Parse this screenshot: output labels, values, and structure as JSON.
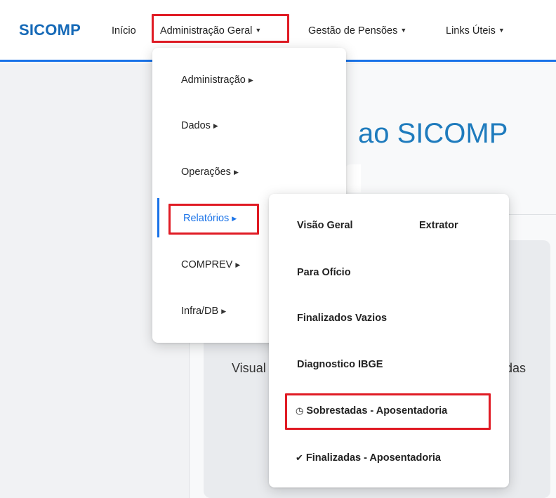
{
  "navbar": {
    "brand": "SICOMP",
    "links": [
      {
        "label": "Início"
      },
      {
        "label": "Administração Geral"
      },
      {
        "label": "Gestão de Pensões"
      },
      {
        "label": "Links Úteis"
      }
    ]
  },
  "page": {
    "welcome_heading": "ao SICOMP",
    "card_text_left": "Visual",
    "card_text_right": "das"
  },
  "admin_menu": {
    "items": [
      {
        "label": "Administração"
      },
      {
        "label": "Dados"
      },
      {
        "label": "Operações"
      },
      {
        "label": "Relatórios"
      },
      {
        "label": "COMPREV"
      },
      {
        "label": "Infra/DB"
      }
    ]
  },
  "reports_menu": {
    "items": [
      {
        "label": "Visão Geral"
      },
      {
        "label": "Extrator"
      },
      {
        "label": "Para Ofício"
      },
      {
        "label": "Finalizados Vazios"
      },
      {
        "label": "Diagnostico IBGE"
      },
      {
        "label": "Sobrestadas - Aposentadoria",
        "icon": "clock-icon"
      },
      {
        "label": "Finalizadas - Aposentadoria",
        "icon": "check-icon"
      }
    ]
  },
  "colors": {
    "accent": "#1a73e8",
    "brand": "#1569b7",
    "highlight": "#e01b24"
  }
}
